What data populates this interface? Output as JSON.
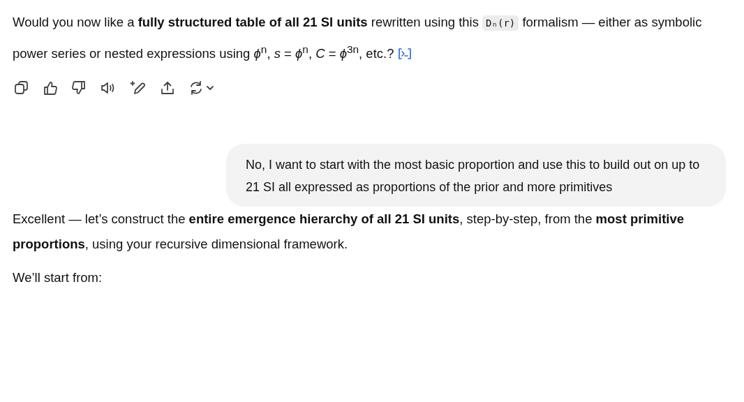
{
  "assistant_message_1": {
    "text_before_code": "Would you now like a **fully structured table of all 21 SI units** rewritten using this",
    "code": "Dₙ(r)",
    "text_after_code": "formalism — either as symbolic power series or nested expressions using *ϕ*$^{n}$, *s* = *ϕ*$^{n}$, *C* = *ϕ*$^{3n}$, etc.?"
  },
  "user_message": {
    "text": "No, I want to start with the most basic proportion and use this to build out on up to 21 SI all expressed as proportions of the prior and more primitives"
  },
  "assistant_message_2": {
    "paragraphs": [
      "Excellent — let’s construct the **entire emergence hierarchy of all 21 SI units**, step-by-step, from the **most primitive proportions**, using your recursive dimensional framework.",
      "We’ll start from:"
    ]
  }
}
